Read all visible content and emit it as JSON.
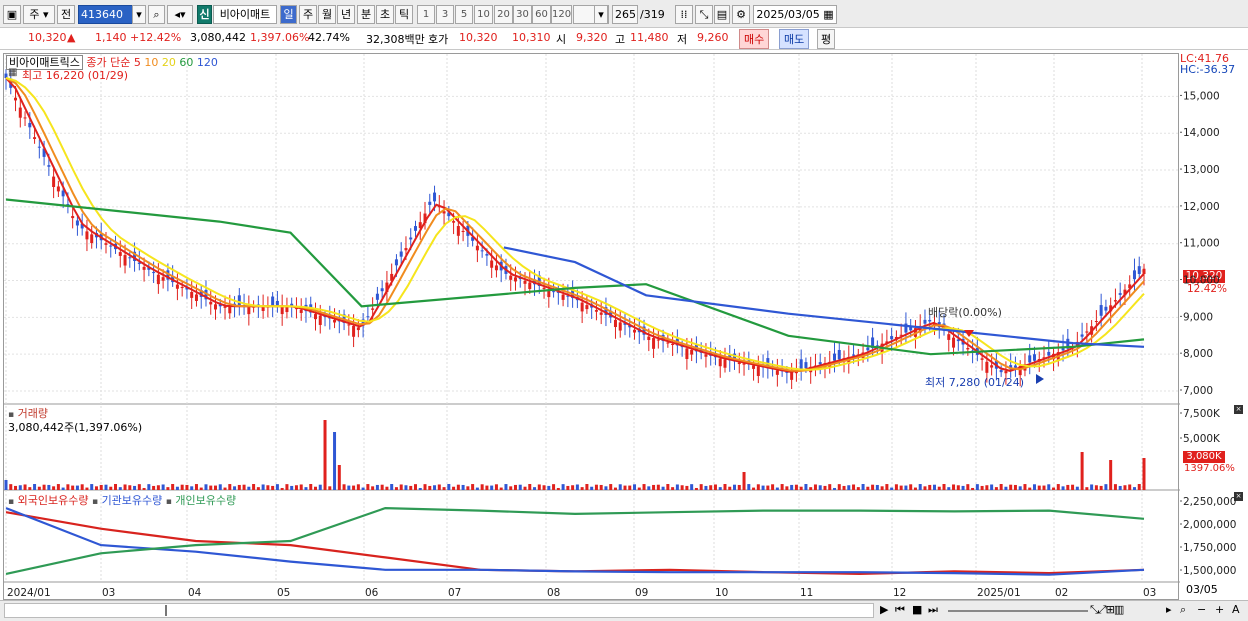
{
  "toolbar": {
    "market_type": "주",
    "prev_label": "전",
    "stock_code": "413640",
    "sin_badge": "신",
    "stock_name": "비아이매트",
    "periods": [
      "일",
      "주",
      "월",
      "년",
      "분",
      "초",
      "틱"
    ],
    "active_period": "일",
    "minute_steps": [
      "1",
      "3",
      "5",
      "10",
      "20",
      "30",
      "60",
      "120"
    ],
    "count": "265",
    "total": "/319",
    "date": "2025/03/05"
  },
  "quote": {
    "price": "10,320",
    "arrow": "▲",
    "change": "1,140",
    "change_pct": "+12.42%",
    "volume": "3,080,442",
    "volume_ratio": "1,397.06%",
    "turnover": "42.74%",
    "trade_value": "32,308백만",
    "hoga_label": "호가",
    "ask": "10,320",
    "bid": "10,310",
    "open_label": "시",
    "open": "9,320",
    "high_label": "고",
    "high": "11,480",
    "low_label": "저",
    "low": "9,260",
    "buy_label": "매수",
    "sell_label": "매도",
    "avg_label": "평"
  },
  "price_panel": {
    "title": "비아이매트릭스",
    "ma_label": "종가 단순",
    "ma_periods": [
      "5",
      "10",
      "20",
      "60",
      "120"
    ],
    "ma_colors": [
      "#e0211d",
      "#f08c1e",
      "#f6e51d",
      "#239a3e",
      "#2f57d4"
    ],
    "max_label": "최고 16,220 (01/29)",
    "min_label": "최저 7,280 (01/24)",
    "dividend_label": "배당락(0.00%)",
    "lc_label": "LC:41.76",
    "hc_label": "HC:-36.37",
    "last_price_tag": "10,320",
    "last_pct_tag": "12.42%"
  },
  "volume_panel": {
    "title": "거래량",
    "value_label": "3,080,442주(1,397.06%)",
    "last_tag": "3,080K",
    "last_pct": "1397.06%",
    "y_ticks": [
      "7,500K",
      "5,000K"
    ]
  },
  "holding_panel": {
    "series_names": [
      "외국인보유수량",
      "기관보유수량",
      "개인보유수량"
    ],
    "series_colors": [
      "#d8231e",
      "#2f57d4",
      "#2f9a55"
    ],
    "y_ticks": [
      "2,250,000",
      "2,000,000",
      "1,750,000",
      "1,500,000"
    ]
  },
  "x_axis": {
    "labels": [
      "2024/01",
      "03",
      "04",
      "05",
      "06",
      "07",
      "08",
      "09",
      "10",
      "11",
      "12",
      "2025/01",
      "02",
      "03"
    ],
    "right_label": "03/05"
  },
  "chart_data": {
    "type": "candlestick",
    "title": "비아이매트릭스",
    "y_range": [
      7000,
      15500
    ],
    "y_ticks": [
      7000,
      8000,
      9000,
      10000,
      11000,
      12000,
      13000,
      14000,
      15000
    ],
    "close_series": [
      {
        "date": "2024/01",
        "close": 15500
      },
      {
        "date": "2024/01b",
        "close": 11500
      },
      {
        "date": "2024/02",
        "close": 10300
      },
      {
        "date": "2024/03",
        "close": 9300
      },
      {
        "date": "2024/04",
        "close": 9300
      },
      {
        "date": "2024/05",
        "close": 8700
      },
      {
        "date": "2024/05b",
        "close": 12200
      },
      {
        "date": "2024/06",
        "close": 10200
      },
      {
        "date": "2024/07",
        "close": 9500
      },
      {
        "date": "2024/08",
        "close": 8500
      },
      {
        "date": "2024/09",
        "close": 7900
      },
      {
        "date": "2024/10",
        "close": 7500
      },
      {
        "date": "2024/11",
        "close": 8000
      },
      {
        "date": "2024/12",
        "close": 8900
      },
      {
        "date": "2025/01",
        "close": 7500
      },
      {
        "date": "2025/02",
        "close": 8200
      },
      {
        "date": "2025/03",
        "close": 10320
      }
    ],
    "ma120": [
      {
        "date": "2024/06",
        "value": 10900
      },
      {
        "date": "2024/07",
        "value": 10500
      },
      {
        "date": "2024/08",
        "value": 9600
      },
      {
        "date": "2024/10",
        "value": 9100
      },
      {
        "date": "2024/12",
        "value": 8700
      },
      {
        "date": "2025/02",
        "value": 8300
      },
      {
        "date": "2025/03",
        "value": 8200
      }
    ],
    "ma60": [
      {
        "date": "2024/01",
        "value": 12200
      },
      {
        "date": "2024/03",
        "value": 11600
      },
      {
        "date": "2024/04",
        "value": 11300
      },
      {
        "date": "2024/05",
        "value": 9300
      },
      {
        "date": "2024/07",
        "value": 9800
      },
      {
        "date": "2024/08",
        "value": 9900
      },
      {
        "date": "2024/10",
        "value": 8500
      },
      {
        "date": "2024/12",
        "value": 8000
      },
      {
        "date": "2025/02",
        "value": 8200
      },
      {
        "date": "2025/03",
        "value": 8400
      }
    ],
    "holdings": {
      "foreign": [
        2200000,
        2000000,
        1850000,
        1800000,
        1650000,
        1500000,
        1480000,
        1500000,
        1470000,
        1450000,
        1480000,
        1460000,
        1500000
      ],
      "institution": [
        2250000,
        1800000,
        1720000,
        1600000,
        1500000,
        1500000,
        1480000,
        1470000,
        1470000,
        1470000,
        1460000,
        1440000,
        1500000
      ],
      "individual": [
        1450000,
        1700000,
        1800000,
        1850000,
        2250000,
        2220000,
        2180000,
        2200000,
        2220000,
        2220000,
        2210000,
        2220000,
        2120000
      ]
    }
  },
  "bottombar": {
    "icons": [
      "play-icon",
      "prev-end-icon",
      "stop-icon",
      "next-end-icon",
      "zoom-icon",
      "minus-icon",
      "plus-icon",
      "font-icon"
    ]
  }
}
